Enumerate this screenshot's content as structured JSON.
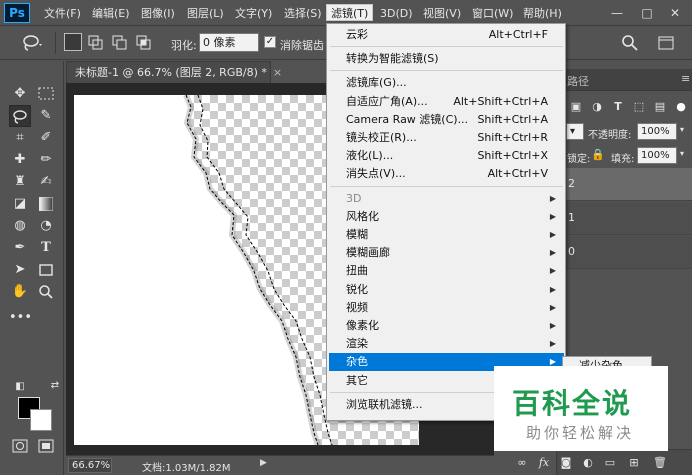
{
  "app": {
    "logo": "Ps"
  },
  "menubar": {
    "items": [
      "文件(F)",
      "编辑(E)",
      "图像(I)",
      "图层(L)",
      "文字(Y)",
      "选择(S)",
      "滤镜(T)",
      "3D(D)",
      "视图(V)",
      "窗口(W)",
      "帮助(H)"
    ],
    "active_index": 6,
    "window_buttons": [
      "—",
      "□",
      "✕"
    ]
  },
  "options": {
    "feather_label": "羽化:",
    "feather_value": "0 像素",
    "antialias_checked": true,
    "antialias_label": "消除锯齿"
  },
  "document": {
    "tab_title": "未标题-1 @ 66.7% (图层 2, RGB/8) *",
    "close_glyph": "×",
    "zoom": "66.67%",
    "info": "文档:1.03M/1.82M"
  },
  "filter_menu": {
    "items": [
      {
        "label": "云彩",
        "shortcut": "Alt+Ctrl+F"
      },
      {
        "separator": true
      },
      {
        "label": "转换为智能滤镜(S)"
      },
      {
        "separator": true
      },
      {
        "label": "滤镜库(G)..."
      },
      {
        "label": "自适应广角(A)...",
        "shortcut": "Alt+Shift+Ctrl+A"
      },
      {
        "label": "Camera Raw 滤镜(C)...",
        "shortcut": "Shift+Ctrl+A"
      },
      {
        "label": "镜头校正(R)...",
        "shortcut": "Shift+Ctrl+R"
      },
      {
        "label": "液化(L)...",
        "shortcut": "Shift+Ctrl+X"
      },
      {
        "label": "消失点(V)...",
        "shortcut": "Alt+Ctrl+V"
      },
      {
        "separator": true
      },
      {
        "label": "3D",
        "submenu": true,
        "disabled": true
      },
      {
        "label": "风格化",
        "submenu": true
      },
      {
        "label": "模糊",
        "submenu": true
      },
      {
        "label": "模糊画廊",
        "submenu": true
      },
      {
        "label": "扭曲",
        "submenu": true
      },
      {
        "label": "锐化",
        "submenu": true
      },
      {
        "label": "视频",
        "submenu": true
      },
      {
        "label": "像素化",
        "submenu": true
      },
      {
        "label": "渲染",
        "submenu": true
      },
      {
        "label": "杂色",
        "submenu": true,
        "highlighted": true
      },
      {
        "label": "其它",
        "submenu": true
      },
      {
        "separator": true
      },
      {
        "label": "浏览联机滤镜..."
      }
    ]
  },
  "submenu": {
    "first_item": "减少杂色..."
  },
  "panel": {
    "tab_fragment": "路径",
    "opacity_label": "不透明度:",
    "opacity_value": "100%",
    "lock_label": "锁定:",
    "fill_label": "填充:",
    "fill_value": "100%",
    "layers": [
      {
        "name": "2",
        "selected": true
      },
      {
        "name": "1",
        "selected": false
      },
      {
        "name": "0",
        "selected": false
      }
    ],
    "footer_icons": [
      "link-icon",
      "fx-icon",
      "mask-icon",
      "adjustment-icon",
      "group-icon",
      "new-layer-icon",
      "trash-icon"
    ]
  },
  "watermark": {
    "main": "百科全说",
    "sub": "助你轻松解决"
  },
  "colors": {
    "menu_highlight": "#0078d7",
    "watermark_green": "#1f9a4e",
    "ps_blue": "#31a8ff"
  }
}
